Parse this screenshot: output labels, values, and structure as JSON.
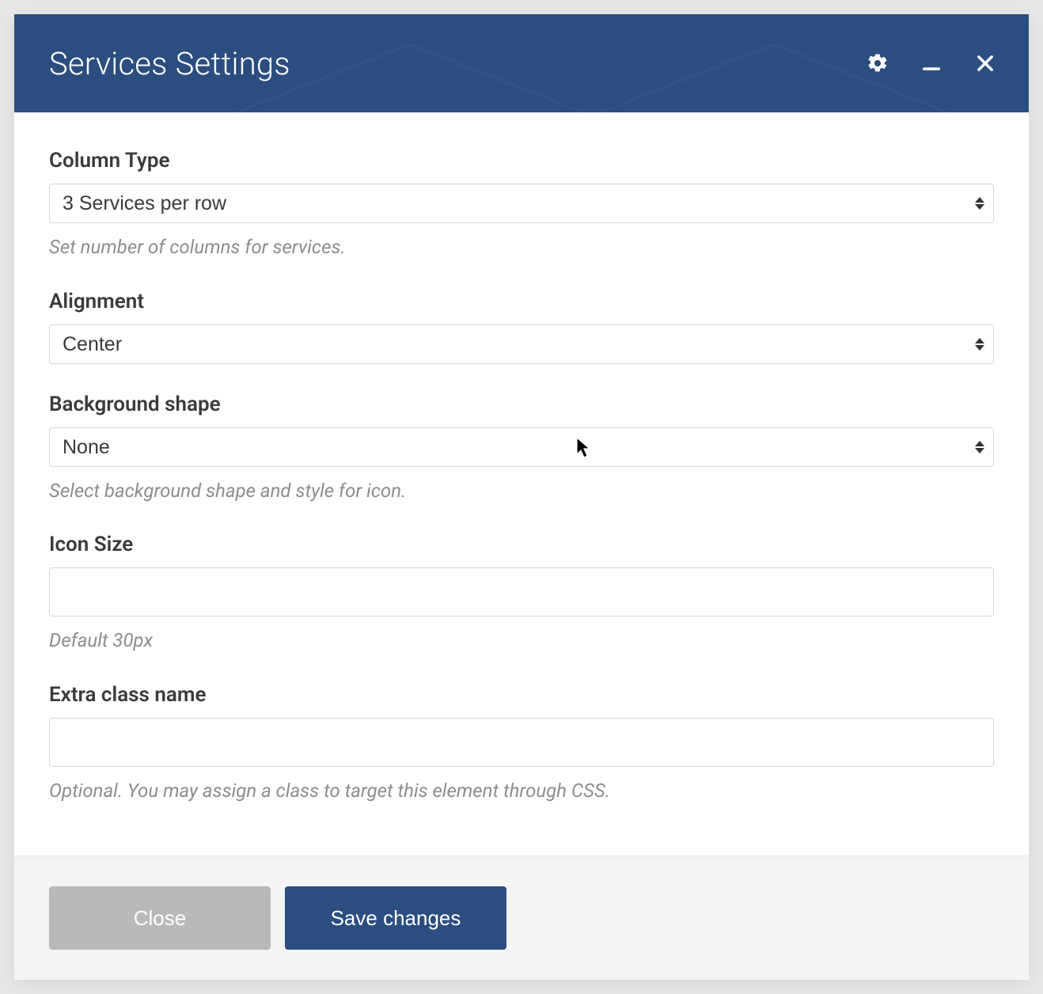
{
  "header": {
    "title": "Services Settings"
  },
  "fields": {
    "column_type": {
      "label": "Column Type",
      "value": "3 Services per row",
      "help": "Set number of columns for services."
    },
    "alignment": {
      "label": "Alignment",
      "value": "Center"
    },
    "background_shape": {
      "label": "Background shape",
      "value": "None",
      "help": "Select background shape and style for icon."
    },
    "icon_size": {
      "label": "Icon Size",
      "value": "",
      "help": "Default 30px"
    },
    "extra_class": {
      "label": "Extra class name",
      "value": "",
      "help": "Optional. You may assign a class to target this element through CSS."
    }
  },
  "footer": {
    "close": "Close",
    "save": "Save changes"
  }
}
